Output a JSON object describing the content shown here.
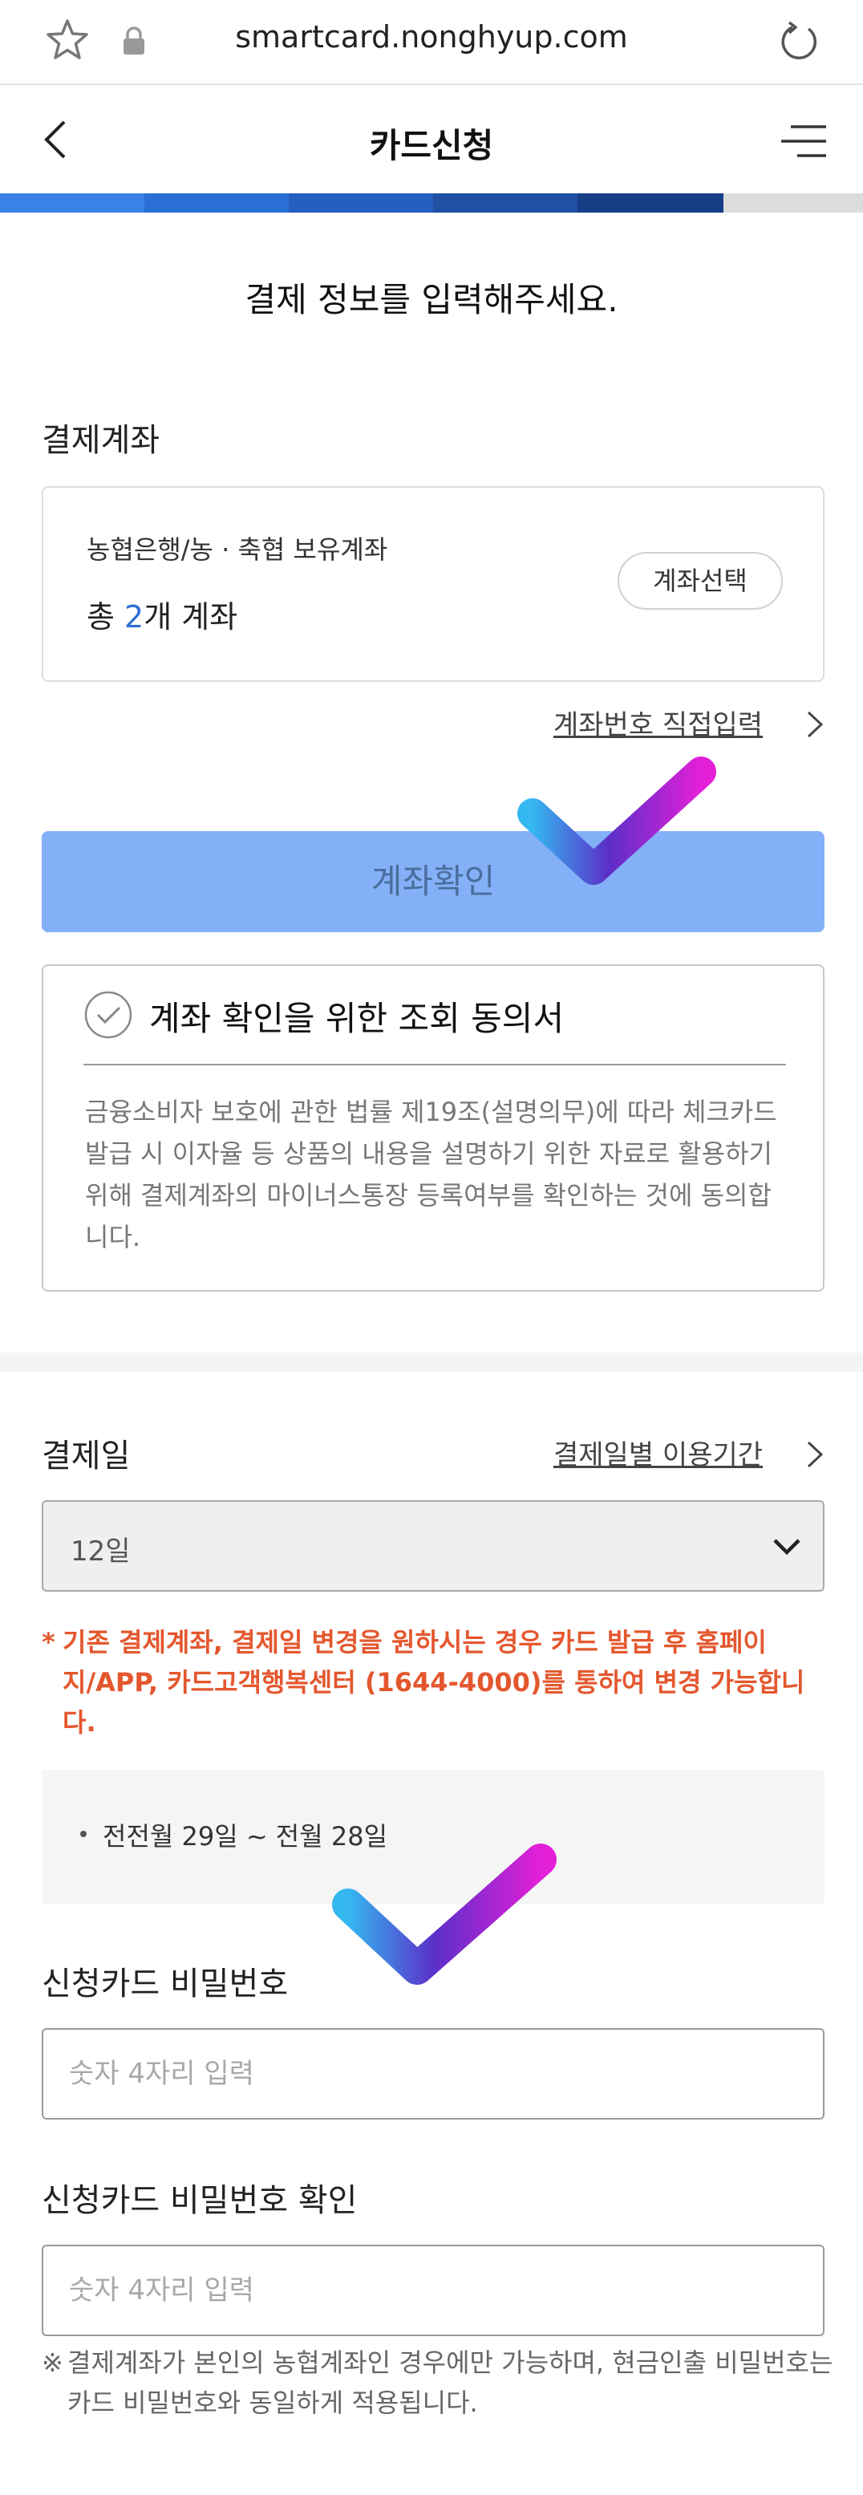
{
  "browser": {
    "url": "smartcard.nonghyup.com"
  },
  "header": {
    "title": "카드신청"
  },
  "progress_colors": [
    "#3b82e6",
    "#2a70d4",
    "#2560c0",
    "#1e50a4",
    "#163e86",
    "#dcdcdc"
  ],
  "heading": "결제 정보를 입력해주세요.",
  "account": {
    "section_label": "결제계좌",
    "subtitle": "농협은행/농 · 축협 보유계좌",
    "total_prefix": "총 ",
    "total_count": "2",
    "total_suffix": "개 계좌",
    "select_button": "계좌선택",
    "direct_input_link": "계좌번호 직접입력",
    "confirm_button": "계좌확인"
  },
  "consent": {
    "title": "계좌 확인을 위한 조회 동의서",
    "body": "금융소비자 보호에 관한 법률 제19조(설명의무)에 따라 체크카드 발급 시 이자율 등 상품의 내용을 설명하기 위한 자료로 활용하기 위해 결제계좌의 마이너스통장 등록여부를 확인하는 것에 동의합니다."
  },
  "payment_day": {
    "section_label": "결제일",
    "usage_link": "결제일별 이용기간",
    "selected": "12일",
    "warning_mark": "*",
    "warning": "기존 결제계좌, 결제일 변경을 원하시는 경우 카드 발급 후 홈페이지/APP, 카드고객행복센터 (1644-4000)를 통하여 변경 가능합니다.",
    "period": "전전월 29일 ~ 전월 28일"
  },
  "password": {
    "label": "신청카드 비밀번호",
    "placeholder": "숫자 4자리 입력",
    "confirm_label": "신청카드 비밀번호 확인",
    "confirm_placeholder": "숫자 4자리 입력",
    "note_mark": "※",
    "note": "결제계좌가 본인의 농협계좌인 경우에만 가능하며, 현금인출 비밀번호는 카드 비밀번호와 동일하게 적용됩니다."
  },
  "colors": {
    "accent_blue": "#2f6fd6",
    "confirm_button_bg": "#84b0f7",
    "warning": "#e4572e",
    "checkmark_start": "#35b8f0",
    "checkmark_mid": "#5b2fc9",
    "checkmark_end": "#e41fd8"
  },
  "icons": [
    "star-icon",
    "lock-icon",
    "reload-icon",
    "back-arrow-icon",
    "menu-icon",
    "chevron-right-icon",
    "check-circle-icon",
    "chevron-down-icon",
    "checkmark-overlay-icon"
  ]
}
